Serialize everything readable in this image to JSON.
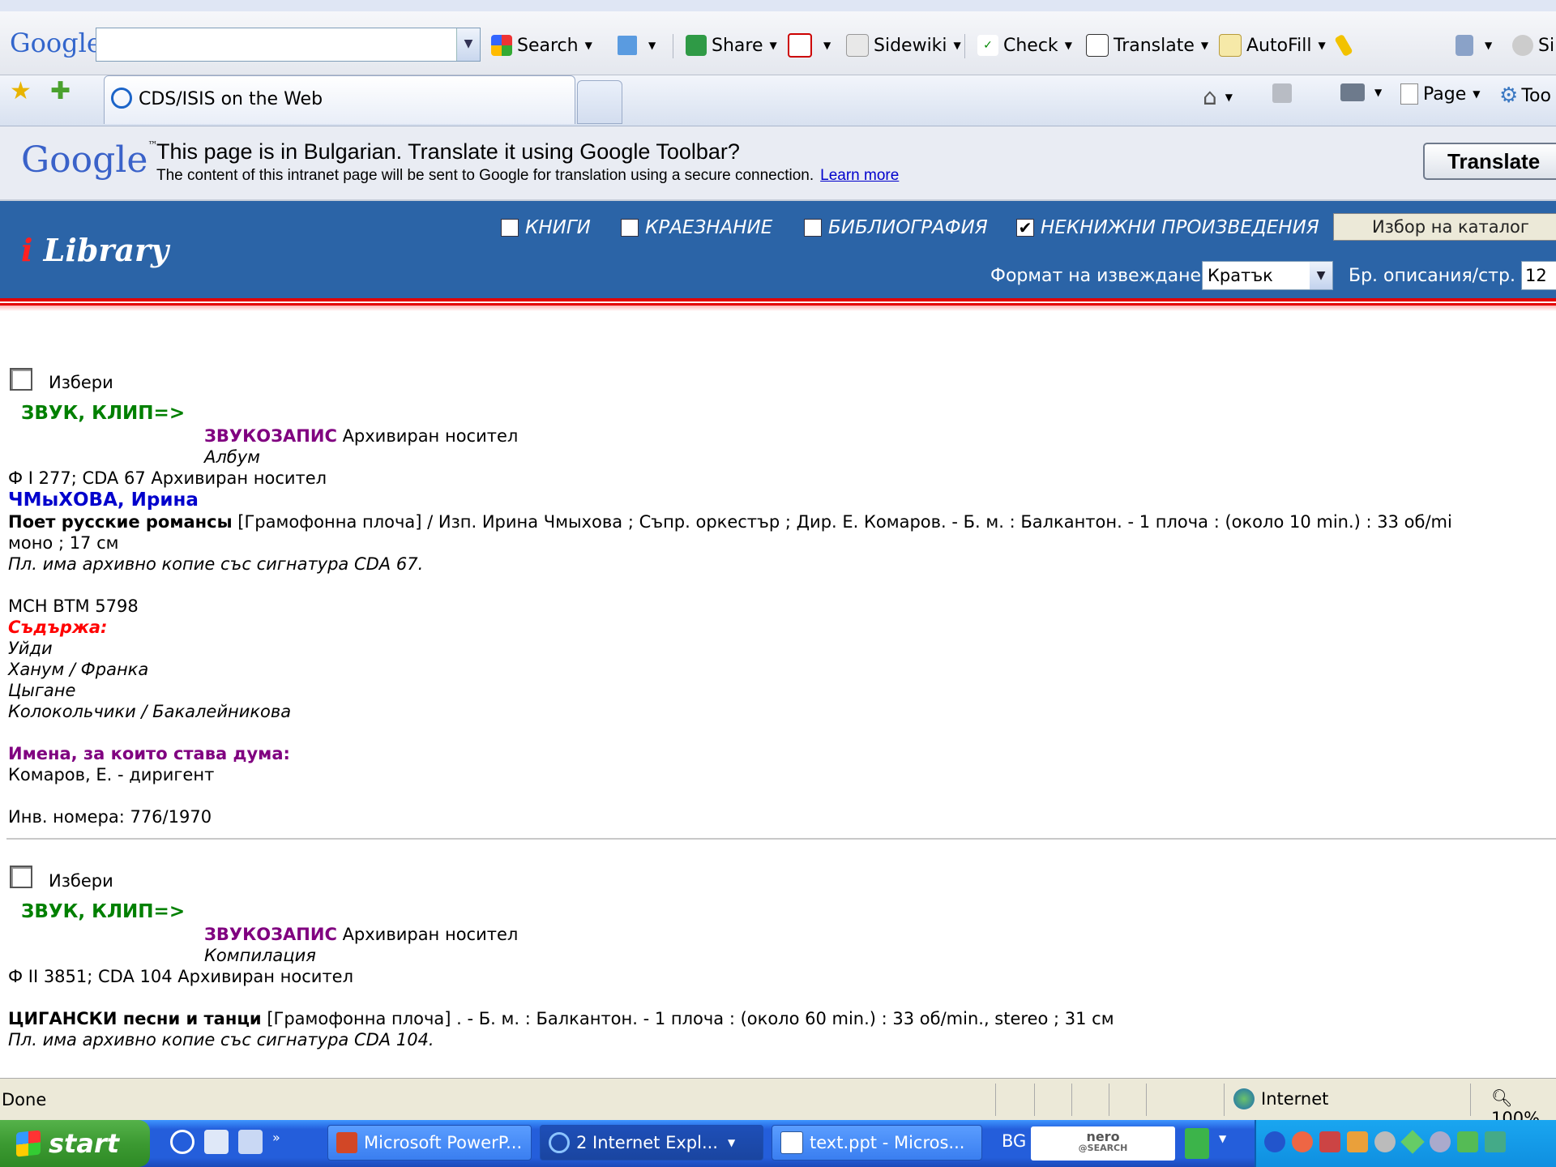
{
  "google_toolbar": {
    "logo": "Google",
    "search_placeholder": "",
    "buttons": {
      "search": "Search",
      "share": "Share",
      "sidewiki": "Sidewiki",
      "check": "Check",
      "translate": "Translate",
      "autofill": "AutoFill",
      "signin": "Si"
    }
  },
  "tabs": {
    "active_title": "CDS/ISIS on the Web"
  },
  "command_bar": {
    "page": "Page",
    "tools": "Too"
  },
  "translate_bar": {
    "logo": "Google",
    "question": "This page is in Bulgarian.  Translate it using Google Toolbar?",
    "sub": "The content of this intranet page will be sent to Google for translation using a secure connection.",
    "learn_more": "Learn more",
    "button": "Translate"
  },
  "library": {
    "logo_i": "i",
    "logo_text": "Library",
    "categories": [
      {
        "label": "КНИГИ",
        "checked": false
      },
      {
        "label": "КРАЕЗНАНИЕ",
        "checked": false
      },
      {
        "label": "БИБЛИОГРАФИЯ",
        "checked": false
      },
      {
        "label": "НЕКНИЖНИ ПРОИЗВЕДЕНИЯ",
        "checked": true
      }
    ],
    "catalog_button": "Избор на каталог",
    "format_label": "Формат на извеждане",
    "format_value": "Кратък",
    "count_label": "Бр. описания/стр.",
    "count_value": "12"
  },
  "records": [
    {
      "select_label": "Избери",
      "type": "ЗВУК, КЛИП=>",
      "media": "ЗВУКОЗАПИС",
      "media_note": "Архивиран носител",
      "kind": "Албум",
      "shelf": "Ф I 277; CDA 67 Архивиран носител",
      "author": "ЧМыХОВА, Ирина",
      "title": "Поет русские романсы",
      "description": "[Грамофонна плоча] / Изп. Ирина Чмыхова ; Съпр. оркестър ; Дир. Е. Комаров. - Б. м. : Балкантон. - 1 плоча : (около 10 min.) : 33 об/mi",
      "description_cont": "моно ; 17 см",
      "note": "Пл. има архивно копие със сигнатура CDA 67.",
      "code": "МСН ВТМ 5798",
      "contains_label": "Съдържа:",
      "contents": [
        "Уйди",
        "Ханум / Франка",
        "Цыгане",
        "Колокольчики / Бакалейникова"
      ],
      "names_label": "Имена, за които става дума:",
      "names": "Комаров, Е. - диригент",
      "inv": "Инв. номера: 776/1970"
    },
    {
      "select_label": "Избери",
      "type": "ЗВУК, КЛИП=>",
      "media": "ЗВУКОЗАПИС",
      "media_note": "Архивиран носител",
      "kind": "Компилация",
      "shelf": "Ф II 3851; CDA 104 Архивиран носител",
      "title": "ЦИГАНСКИ песни и танци",
      "description": "[Грамофонна плоча] . - Б. м. : Балкантон. - 1 плоча : (около 60 min.) : 33 об/min., stereo ; 31 см",
      "note": "Пл. има архивно копие със сигнатура CDA 104."
    }
  ],
  "status_bar": {
    "text": "Done",
    "zone": "Internet",
    "zoom": "100%"
  },
  "taskbar": {
    "start": "start",
    "items": [
      "Microsoft PowerP...",
      "2 Internet Expl...",
      "text.ppt - Micros..."
    ],
    "language": "BG",
    "nero_top": "nero",
    "nero_bottom": "@SEARCH"
  }
}
